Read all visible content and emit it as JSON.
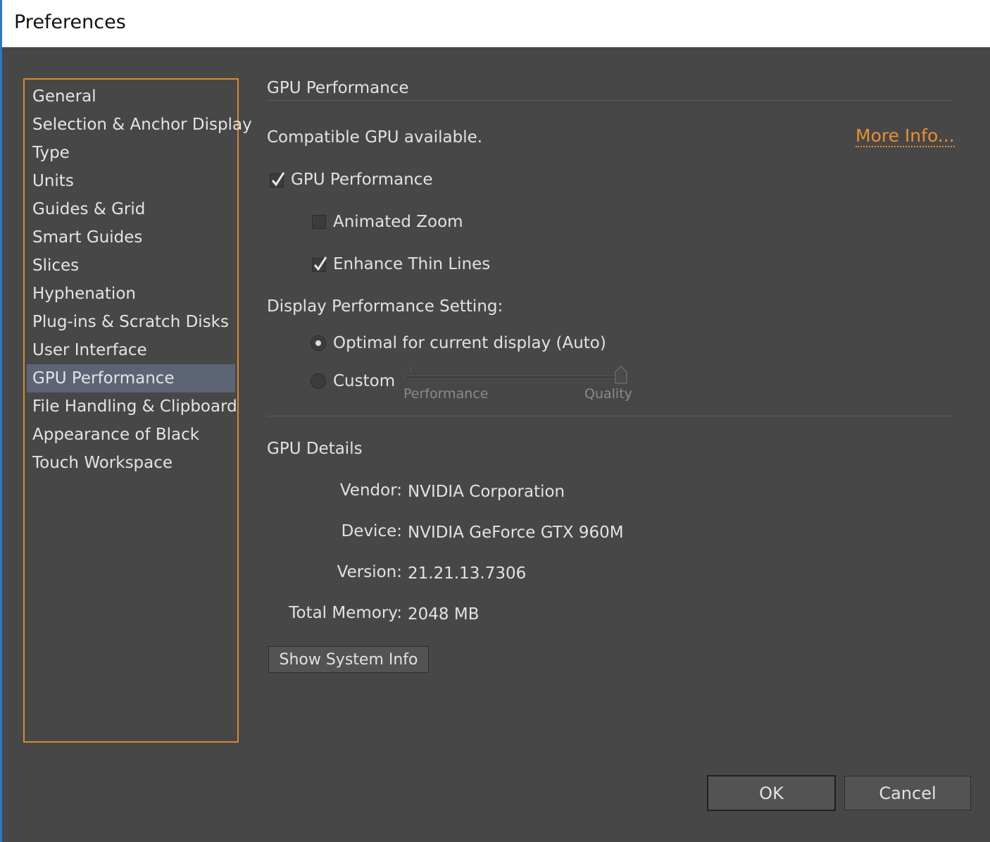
{
  "window": {
    "title": "Preferences"
  },
  "sidebar": {
    "items": [
      {
        "label": "General"
      },
      {
        "label": "Selection & Anchor Display"
      },
      {
        "label": "Type"
      },
      {
        "label": "Units"
      },
      {
        "label": "Guides & Grid"
      },
      {
        "label": "Smart Guides"
      },
      {
        "label": "Slices"
      },
      {
        "label": "Hyphenation"
      },
      {
        "label": "Plug-ins & Scratch Disks"
      },
      {
        "label": "User Interface"
      },
      {
        "label": "GPU Performance",
        "selected": true
      },
      {
        "label": "File Handling & Clipboard"
      },
      {
        "label": "Appearance of Black"
      },
      {
        "label": "Touch Workspace"
      }
    ]
  },
  "main": {
    "section_title": "GPU Performance",
    "status_text": "Compatible GPU available.",
    "more_info_label": "More Info...",
    "gpu_performance": {
      "label": "GPU Performance",
      "checked": true
    },
    "animated_zoom": {
      "label": "Animated Zoom",
      "checked": false
    },
    "enhance_thin_lines": {
      "label": "Enhance Thin Lines",
      "checked": true
    },
    "display_setting": {
      "heading": "Display Performance Setting:",
      "option_auto": "Optimal for current display (Auto)",
      "option_custom": "Custom",
      "selected": "auto",
      "slider": {
        "min_label": "Performance",
        "max_label": "Quality",
        "value": 1.0
      }
    },
    "details": {
      "heading": "GPU Details",
      "vendor_key": "Vendor:",
      "vendor_val": "NVIDIA Corporation",
      "device_key": "Device:",
      "device_val": "NVIDIA GeForce GTX 960M",
      "version_key": "Version:",
      "version_val": "21.21.13.7306",
      "memory_key": "Total Memory:",
      "memory_val": "2048 MB"
    },
    "show_system_info_label": "Show System Info"
  },
  "footer": {
    "ok_label": "OK",
    "cancel_label": "Cancel"
  },
  "colors": {
    "accent": "#e8902f",
    "selection": "#5c6475",
    "background": "#474747"
  }
}
